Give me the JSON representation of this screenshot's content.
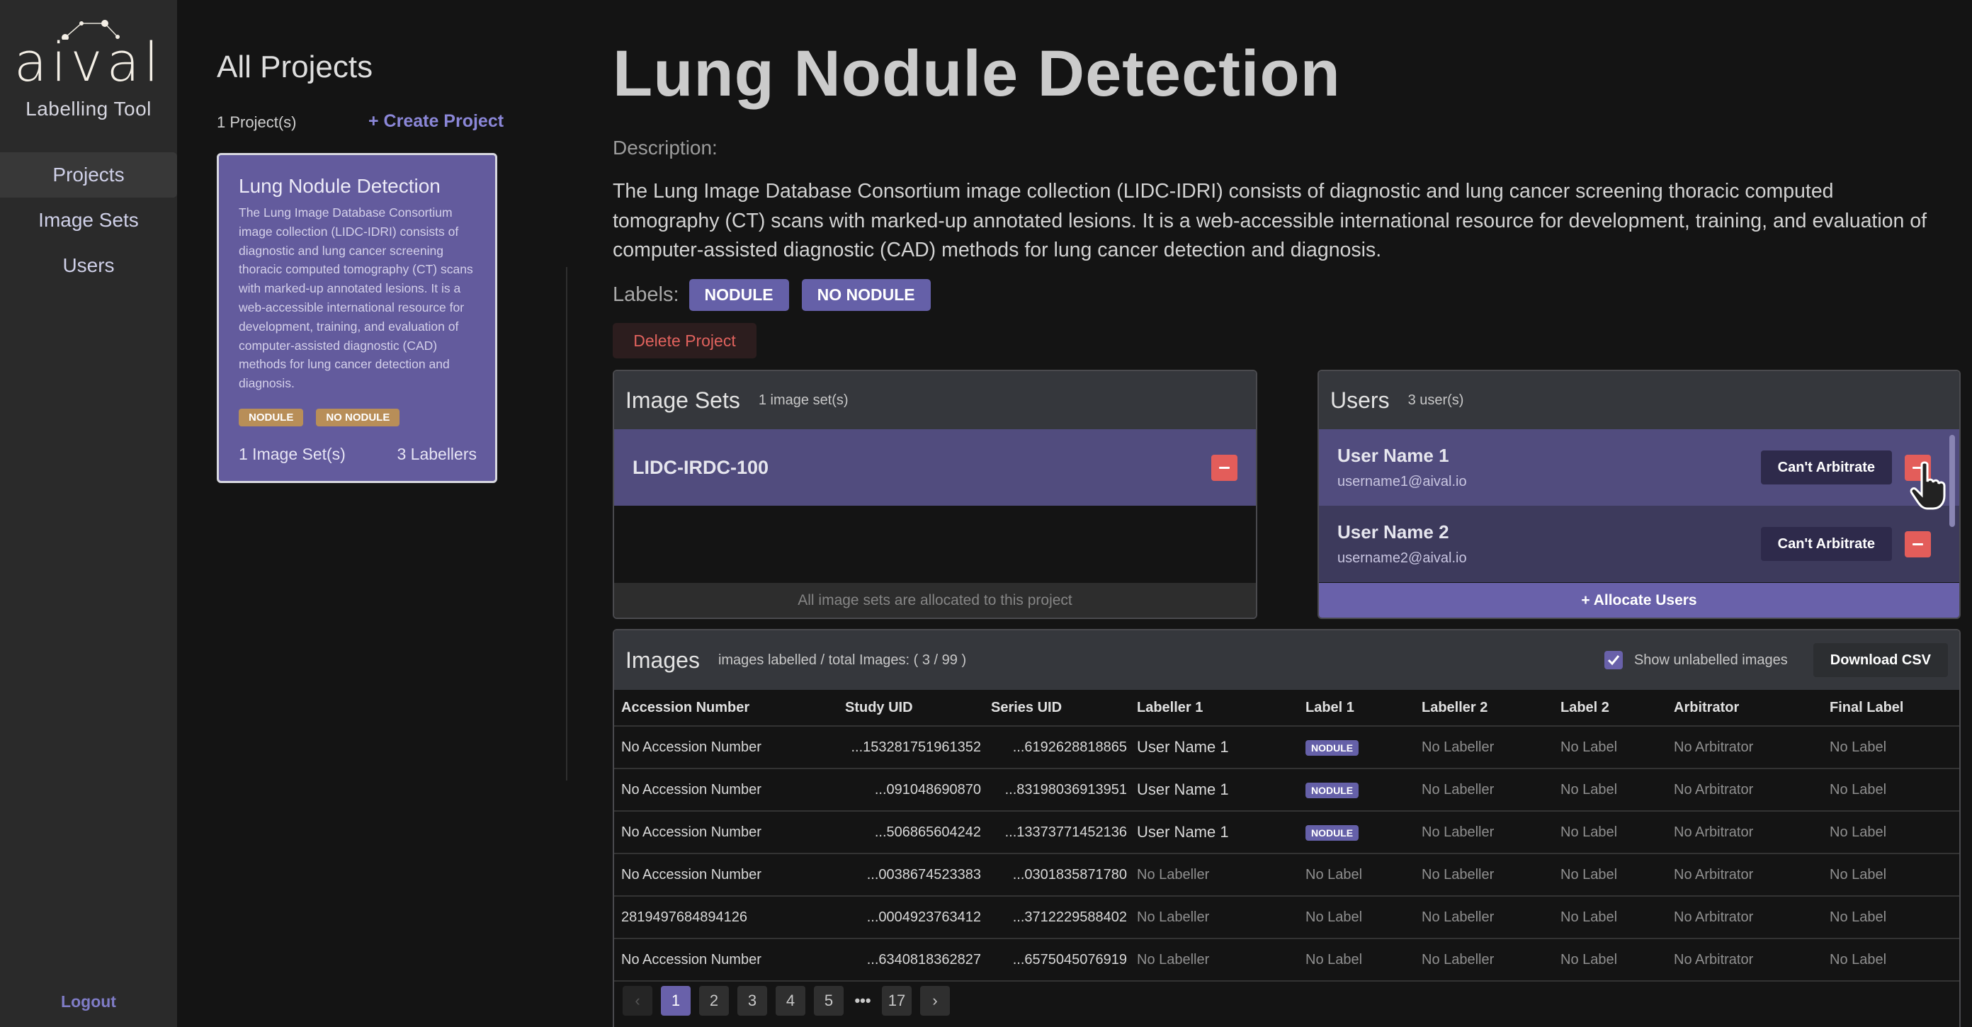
{
  "app": {
    "brand": "aival",
    "subtitle": "Labelling Tool",
    "accent_color": "#6961aa"
  },
  "sidebar": {
    "items": [
      {
        "label": "Projects",
        "active": true
      },
      {
        "label": "Image Sets",
        "active": false
      },
      {
        "label": "Users",
        "active": false
      }
    ],
    "logout_label": "Logout"
  },
  "projects": {
    "title": "All Projects",
    "count_text": "1 Project(s)",
    "create_label": "+ Create Project",
    "cards": [
      {
        "title": "Lung Nodule Detection",
        "description": "The Lung Image Database Consortium image collection (LIDC-IDRI) consists of diagnostic and lung cancer screening thoracic computed tomography (CT) scans with marked-up annotated lesions. It is a web-accessible international resource for development, training, and evaluation of computer-assisted diagnostic (CAD) methods for lung cancer detection and diagnosis.",
        "labels": [
          "NODULE",
          "NO NODULE"
        ],
        "image_sets_text": "1 Image Set(s)",
        "labellers_text": "3 Labellers"
      }
    ]
  },
  "detail": {
    "title": "Lung Nodule Detection",
    "description_label": "Description:",
    "description": "The Lung Image Database Consortium image collection (LIDC-IDRI) consists of diagnostic and lung cancer screening thoracic computed tomography (CT) scans with marked-up annotated lesions. It is a web-accessible international resource for development, training, and evaluation of computer-assisted diagnostic (CAD) methods for lung cancer detection and diagnosis.",
    "labels_caption": "Labels:",
    "labels": [
      "NODULE",
      "NO NODULE"
    ],
    "delete_label": "Delete Project"
  },
  "image_sets_panel": {
    "title": "Image Sets",
    "count_text": "1 image set(s)",
    "sets": [
      {
        "name": "LIDC-IRDC-100"
      }
    ],
    "footer_text": "All image sets are allocated to this project"
  },
  "users_panel": {
    "title": "Users",
    "count_text": "3 user(s)",
    "users": [
      {
        "name": "User Name 1",
        "email": "username1@aival.io",
        "arbitrate_label": "Can't Arbitrate"
      },
      {
        "name": "User Name 2",
        "email": "username2@aival.io",
        "arbitrate_label": "Can't Arbitrate"
      }
    ],
    "allocate_label": "+ Allocate Users"
  },
  "images_panel": {
    "title": "Images",
    "summary": "images labelled / total Images: ( 3 / 99 )",
    "show_unlabelled_label": "Show unlabelled images",
    "show_unlabelled_checked": true,
    "download_label": "Download CSV",
    "columns": [
      "Accession Number",
      "Study UID",
      "Series UID",
      "Labeller 1",
      "Label 1",
      "Labeller 2",
      "Label 2",
      "Arbitrator",
      "Final Label"
    ],
    "rows": [
      {
        "accession": "No Accession Number",
        "study_uid": "...153281751961352",
        "series_uid": "...6192628818865",
        "labeller1": "User Name 1",
        "label1": "NODULE",
        "labeller2": "No Labeller",
        "label2": "No Label",
        "arbitrator": "No Arbitrator",
        "final_label": "No Label"
      },
      {
        "accession": "No Accession Number",
        "study_uid": "...091048690870",
        "series_uid": "...83198036913951",
        "labeller1": "User Name 1",
        "label1": "NODULE",
        "labeller2": "No Labeller",
        "label2": "No Label",
        "arbitrator": "No Arbitrator",
        "final_label": "No Label"
      },
      {
        "accession": "No Accession Number",
        "study_uid": "...506865604242",
        "series_uid": "...13373771452136",
        "labeller1": "User Name 1",
        "label1": "NODULE",
        "labeller2": "No Labeller",
        "label2": "No Label",
        "arbitrator": "No Arbitrator",
        "final_label": "No Label"
      },
      {
        "accession": "No Accession Number",
        "study_uid": "...0038674523383",
        "series_uid": "...0301835871780",
        "labeller1": "No Labeller",
        "label1": "No Label",
        "labeller2": "No Labeller",
        "label2": "No Label",
        "arbitrator": "No Arbitrator",
        "final_label": "No Label"
      },
      {
        "accession": "2819497684894126",
        "study_uid": "...0004923763412",
        "series_uid": "...3712229588402",
        "labeller1": "No Labeller",
        "label1": "No Label",
        "labeller2": "No Labeller",
        "label2": "No Label",
        "arbitrator": "No Arbitrator",
        "final_label": "No Label"
      },
      {
        "accession": "No Accession Number",
        "study_uid": "...6340818362827",
        "series_uid": "...6575045076919",
        "labeller1": "No Labeller",
        "label1": "No Label",
        "labeller2": "No Labeller",
        "label2": "No Label",
        "arbitrator": "No Arbitrator",
        "final_label": "No Label"
      }
    ],
    "pagination": {
      "prev_icon": "chevron-left-icon",
      "next_icon": "chevron-right-icon",
      "pages": [
        "1",
        "2",
        "3",
        "4",
        "5",
        "...",
        "17"
      ],
      "current": "1"
    }
  }
}
